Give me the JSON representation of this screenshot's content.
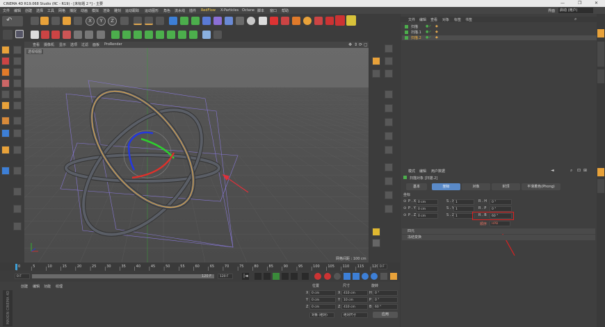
{
  "app": {
    "title": "CINEMA 4D R19.068 Studio (RC - R19) - [未标题 2 *] - 主要"
  },
  "layout_dropdown": {
    "label": "界面",
    "value": "启动 (用户)"
  },
  "menu": [
    "文件",
    "编辑",
    "创建",
    "选择",
    "工具",
    "网格",
    "捕捉",
    "动画",
    "模拟",
    "渲染",
    "雕刻",
    "运动跟踪",
    "运动图形",
    "角色",
    "流水线",
    "插件",
    "RedFlow",
    "X-Particles",
    "Octane",
    "脚本",
    "窗口",
    "帮助"
  ],
  "viewport": {
    "menu": [
      "查看",
      "摄像机",
      "显示",
      "选项",
      "过滤",
      "面板",
      "ProRender"
    ],
    "camera": "透视视图",
    "grid_spacing": "网格间距 : 100 cm",
    "colors": {
      "bg": "#5c5c5c",
      "ring": "#5a5e66",
      "selected": "#e0a84f",
      "axis_x": "#e0302a",
      "axis_y": "#2ecf2e",
      "axis_z": "#2438e0",
      "wire": "#8878d8",
      "arrow": "#e0303a"
    }
  },
  "timeline": {
    "ticks": [
      "0",
      "5",
      "10",
      "15",
      "20",
      "25",
      "30",
      "35",
      "40",
      "45",
      "50",
      "55",
      "60",
      "65",
      "70",
      "75",
      "80",
      "85",
      "90",
      "95",
      "100",
      "105",
      "110",
      "115",
      "120"
    ],
    "current_frame": "0 F",
    "start_frame": "0 F",
    "preview_end": "120 F",
    "end_frame": "120 F",
    "right_frame": "0 F"
  },
  "material_manager": {
    "menu": [
      "创建",
      "编辑",
      "功能",
      "纹理"
    ],
    "brand": "MAXON CINEMA 4D"
  },
  "coordinates": {
    "headers": [
      "位置",
      "尺寸",
      "旋转"
    ],
    "rows": [
      {
        "axis": "X",
        "pos": "0 cm",
        "size": "410 cm",
        "rot_axis": "H",
        "rot": "0 °"
      },
      {
        "axis": "Y",
        "pos": "0 cm",
        "size": "10 cm",
        "rot_axis": "P",
        "rot": "0 °"
      },
      {
        "axis": "Z",
        "pos": "0 cm",
        "size": "410 cm",
        "rot_axis": "B",
        "rot": "60 °"
      }
    ],
    "mode": "对象 (相对)",
    "size_mode": "绝对尺寸",
    "apply": "应用"
  },
  "object_manager": {
    "menu": [
      "文件",
      "编辑",
      "查看",
      "对象",
      "标签",
      "书签"
    ],
    "objects": [
      "扫描",
      "扫描.1",
      "扫描.2"
    ]
  },
  "attributes": {
    "menu": [
      "模式",
      "编辑",
      "用户数据"
    ],
    "object_title": "扫描对象 [扫描.2]",
    "tabs": [
      "基本",
      "坐标",
      "对象",
      "封顶",
      "平滑着色(Phong)"
    ],
    "active_tab": "坐标",
    "section": "坐标",
    "rows": [
      {
        "p_label": "P . X",
        "p": "0 cm",
        "s_label": "S . X",
        "s": "1",
        "r_label": "R . H",
        "r": "0 °"
      },
      {
        "p_label": "P . Y",
        "p": "0 cm",
        "s_label": "S . Y",
        "s": "1",
        "r_label": "R . P",
        "r": "0 °"
      },
      {
        "p_label": "P . Z",
        "p": "0 cm",
        "s_label": "S . Z",
        "s": "1",
        "r_label": "R . B",
        "r": "60 °"
      }
    ],
    "order_label": "顺序",
    "order_value": "HPB",
    "collapsed": [
      "四元",
      "冻结变换"
    ]
  },
  "right_tabs": [
    "对象",
    "内容浏览器",
    "构造"
  ],
  "highlight_color": "#e02020"
}
